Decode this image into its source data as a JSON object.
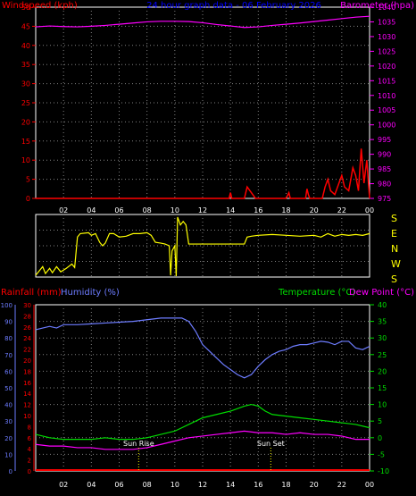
{
  "header": {
    "left_label": "Windspeed (kph)",
    "center_label": "24 hour graph data - 06 February 2026",
    "right_label": "Barometer (hpa)"
  },
  "direction_labels": [
    "S",
    "E",
    "N",
    "W",
    "S"
  ],
  "lower_header": {
    "rainfall_label": "Rainfall (mm)",
    "humidity_label": "Humidity (%)",
    "temperature_label": "Temperature (°C)",
    "dewpoint_label": "Dew Point (°C)"
  },
  "annotations": {
    "sunrise_label": "Sun Rise",
    "sunset_label": "Sun Set"
  },
  "colors": {
    "background": "#000000",
    "frame": "#ffffff",
    "grid": "#808080",
    "windspeed": "#ff0000",
    "barometer": "#ff00ff",
    "title": "#0000ff",
    "direction": "#ffff00",
    "humidity": "#6d7cff",
    "temperature": "#00dd00",
    "dewpoint": "#ff00ff",
    "rainfall": "#ff0000",
    "sun": "#ffff00"
  },
  "chart_data": [
    {
      "type": "line",
      "name": "wind-barometer",
      "x_ticks": [
        "02",
        "04",
        "06",
        "08",
        "10",
        "12",
        "14",
        "16",
        "18",
        "20",
        "22",
        "00"
      ],
      "y_left_ticks": [
        "0",
        "5",
        "10",
        "15",
        "20",
        "25",
        "30",
        "35",
        "40",
        "45",
        "50"
      ],
      "y_right_ticks": [
        "975",
        "980",
        "985",
        "990",
        "995",
        "1000",
        "1005",
        "1010",
        "1015",
        "1020",
        "1025",
        "1030",
        "1035",
        "1040"
      ],
      "ylim_left": [
        0,
        50
      ],
      "ylim_right": [
        975,
        1040
      ],
      "xlim": [
        0,
        24
      ],
      "grid": true,
      "series": [
        {
          "axis": "right",
          "points": [
            [
              0,
              1033.3
            ],
            [
              1,
              1033.6
            ],
            [
              2,
              1033.4
            ],
            [
              3,
              1033.3
            ],
            [
              4,
              1033.5
            ],
            [
              5,
              1033.8
            ],
            [
              6,
              1034.2
            ],
            [
              7,
              1034.6
            ],
            [
              8,
              1035
            ],
            [
              9,
              1035.2
            ],
            [
              10,
              1035.2
            ],
            [
              11,
              1035.1
            ],
            [
              12,
              1034.7
            ],
            [
              13,
              1034.1
            ],
            [
              14,
              1033.6
            ],
            [
              15,
              1033.1
            ],
            [
              16,
              1033.3
            ],
            [
              17,
              1033.8
            ],
            [
              18,
              1034.2
            ],
            [
              19,
              1034.6
            ],
            [
              20,
              1035.1
            ],
            [
              21,
              1035.6
            ],
            [
              22,
              1036.1
            ],
            [
              23,
              1036.6
            ],
            [
              24,
              1036.9
            ]
          ]
        },
        {
          "axis": "left",
          "points": [
            [
              0,
              0
            ],
            [
              13.9,
              0
            ],
            [
              14,
              1.5
            ],
            [
              14.1,
              0
            ],
            [
              15,
              0
            ],
            [
              15.2,
              3
            ],
            [
              15.4,
              2
            ],
            [
              15.6,
              1
            ],
            [
              15.8,
              0
            ],
            [
              18,
              0
            ],
            [
              18.2,
              1.5
            ],
            [
              18.3,
              0
            ],
            [
              19.4,
              0
            ],
            [
              19.5,
              2.5
            ],
            [
              19.6,
              1
            ],
            [
              19.7,
              0
            ],
            [
              20.6,
              0
            ],
            [
              20.8,
              3
            ],
            [
              21,
              5
            ],
            [
              21.2,
              2
            ],
            [
              21.5,
              1
            ],
            [
              21.8,
              4
            ],
            [
              22,
              6
            ],
            [
              22.2,
              3
            ],
            [
              22.5,
              2
            ],
            [
              22.8,
              8
            ],
            [
              23,
              6
            ],
            [
              23.2,
              2
            ],
            [
              23.4,
              13
            ],
            [
              23.6,
              4
            ],
            [
              23.8,
              10
            ],
            [
              24,
              0
            ]
          ]
        }
      ]
    },
    {
      "type": "line",
      "name": "wind-direction",
      "x_ticks": [
        "02",
        "04",
        "06",
        "08",
        "10",
        "12",
        "14",
        "16",
        "18",
        "20",
        "22",
        "00"
      ],
      "ylim": [
        0,
        360
      ],
      "xlim": [
        0,
        24
      ],
      "grid": true,
      "series": [
        {
          "points": [
            [
              0,
              10
            ],
            [
              0.3,
              40
            ],
            [
              0.5,
              60
            ],
            [
              0.7,
              20
            ],
            [
              1,
              50
            ],
            [
              1.2,
              25
            ],
            [
              1.5,
              60
            ],
            [
              1.8,
              30
            ],
            [
              2.2,
              50
            ],
            [
              2.6,
              75
            ],
            [
              2.8,
              55
            ],
            [
              3,
              230
            ],
            [
              3.2,
              250
            ],
            [
              3.8,
              255
            ],
            [
              4,
              240
            ],
            [
              4.3,
              250
            ],
            [
              4.6,
              200
            ],
            [
              4.8,
              180
            ],
            [
              5,
              195
            ],
            [
              5.3,
              250
            ],
            [
              5.6,
              250
            ],
            [
              6,
              230
            ],
            [
              6.5,
              235
            ],
            [
              7,
              250
            ],
            [
              7.5,
              250
            ],
            [
              8,
              255
            ],
            [
              8.3,
              240
            ],
            [
              8.6,
              200
            ],
            [
              9,
              195
            ],
            [
              9.3,
              190
            ],
            [
              9.6,
              180
            ],
            [
              9.7,
              10
            ],
            [
              9.8,
              150
            ],
            [
              10,
              180
            ],
            [
              10.1,
              5
            ],
            [
              10.2,
              345
            ],
            [
              10.4,
              300
            ],
            [
              10.6,
              320
            ],
            [
              10.8,
              300
            ],
            [
              11,
              190
            ],
            [
              11.5,
              190
            ],
            [
              12,
              190
            ],
            [
              13,
              190
            ],
            [
              14,
              190
            ],
            [
              15,
              190
            ],
            [
              15.2,
              230
            ],
            [
              15.5,
              235
            ],
            [
              16,
              240
            ],
            [
              17,
              245
            ],
            [
              18,
              240
            ],
            [
              19,
              235
            ],
            [
              20,
              240
            ],
            [
              20.5,
              230
            ],
            [
              21,
              250
            ],
            [
              21.5,
              235
            ],
            [
              22,
              245
            ],
            [
              22.5,
              240
            ],
            [
              23,
              245
            ],
            [
              23.5,
              240
            ],
            [
              24,
              250
            ]
          ]
        }
      ]
    },
    {
      "type": "line",
      "name": "humidity-temperature",
      "x_ticks": [
        "02",
        "04",
        "06",
        "08",
        "10",
        "12",
        "14",
        "16",
        "18",
        "20",
        "22",
        "00"
      ],
      "y_left_ticks": [
        "0",
        "10",
        "20",
        "30",
        "40",
        "50",
        "60",
        "70",
        "80",
        "90",
        "100"
      ],
      "y_inner_ticks": [
        "0",
        "2",
        "4",
        "6",
        "8",
        "10",
        "12",
        "14",
        "16",
        "18",
        "20",
        "22",
        "24",
        "26",
        "28",
        "30"
      ],
      "y_right_ticks": [
        "-10",
        "-5",
        "0",
        "5",
        "10",
        "15",
        "20",
        "25",
        "30",
        "35",
        "40"
      ],
      "ylim_humidity": [
        0,
        100
      ],
      "ylim_rainfall": [
        0,
        30
      ],
      "ylim_temperature": [
        -10,
        40
      ],
      "xlim": [
        0,
        24
      ],
      "grid": true,
      "sunrise_hour": 7.4,
      "sunset_hour": 16.9,
      "series": [
        {
          "points": [
            [
              0,
              85
            ],
            [
              0.5,
              86
            ],
            [
              1,
              87
            ],
            [
              1.5,
              86
            ],
            [
              2,
              88
            ],
            [
              3,
              88
            ],
            [
              4,
              88.5
            ],
            [
              5,
              89
            ],
            [
              6,
              89.5
            ],
            [
              7,
              90
            ],
            [
              8,
              91
            ],
            [
              9,
              92
            ],
            [
              10,
              92
            ],
            [
              10.5,
              92
            ],
            [
              11,
              90
            ],
            [
              11.5,
              84
            ],
            [
              12,
              76
            ],
            [
              12.5,
              72
            ],
            [
              13,
              68
            ],
            [
              13.5,
              64
            ],
            [
              14,
              61
            ],
            [
              14.5,
              58
            ],
            [
              15,
              56
            ],
            [
              15.5,
              58
            ],
            [
              16,
              63
            ],
            [
              16.5,
              67
            ],
            [
              17,
              70
            ],
            [
              17.5,
              72
            ],
            [
              18,
              73
            ],
            [
              18.5,
              75
            ],
            [
              19,
              76
            ],
            [
              19.5,
              76
            ],
            [
              20,
              77
            ],
            [
              20.5,
              78
            ],
            [
              21,
              77.5
            ],
            [
              21.5,
              76
            ],
            [
              22,
              78
            ],
            [
              22.5,
              78
            ],
            [
              23,
              74
            ],
            [
              23.5,
              73
            ],
            [
              24,
              75
            ]
          ]
        },
        {
          "points": [
            [
              0,
              1
            ],
            [
              1,
              0
            ],
            [
              2,
              -0.5
            ],
            [
              3,
              -0.5
            ],
            [
              4,
              -0.5
            ],
            [
              5,
              0
            ],
            [
              6,
              -0.5
            ],
            [
              7,
              -0.5
            ],
            [
              8,
              0
            ],
            [
              9,
              1
            ],
            [
              10,
              2
            ],
            [
              11,
              4
            ],
            [
              12,
              6
            ],
            [
              13,
              7
            ],
            [
              14,
              8
            ],
            [
              15,
              9.5
            ],
            [
              15.5,
              10
            ],
            [
              16,
              9.5
            ],
            [
              16.5,
              8
            ],
            [
              17,
              7
            ],
            [
              18,
              6.5
            ],
            [
              19,
              6
            ],
            [
              20,
              5.5
            ],
            [
              21,
              5
            ],
            [
              22,
              4.5
            ],
            [
              23,
              4
            ],
            [
              24,
              3
            ]
          ]
        },
        {
          "points": [
            [
              0,
              -2
            ],
            [
              1,
              -2.5
            ],
            [
              2,
              -2.5
            ],
            [
              3,
              -3
            ],
            [
              4,
              -3
            ],
            [
              5,
              -3.5
            ],
            [
              6,
              -3.5
            ],
            [
              7,
              -3.5
            ],
            [
              8,
              -3
            ],
            [
              9,
              -2
            ],
            [
              10,
              -1
            ],
            [
              11,
              0
            ],
            [
              12,
              0.5
            ],
            [
              13,
              1
            ],
            [
              14,
              1.5
            ],
            [
              15,
              2
            ],
            [
              16,
              1.5
            ],
            [
              17,
              1.5
            ],
            [
              18,
              1
            ],
            [
              19,
              1.5
            ],
            [
              20,
              1
            ],
            [
              21,
              1
            ],
            [
              22,
              0.5
            ],
            [
              23,
              -0.5
            ],
            [
              24,
              -0.5
            ]
          ]
        },
        {
          "points": [
            [
              0,
              0
            ],
            [
              24,
              0
            ]
          ]
        }
      ]
    }
  ]
}
